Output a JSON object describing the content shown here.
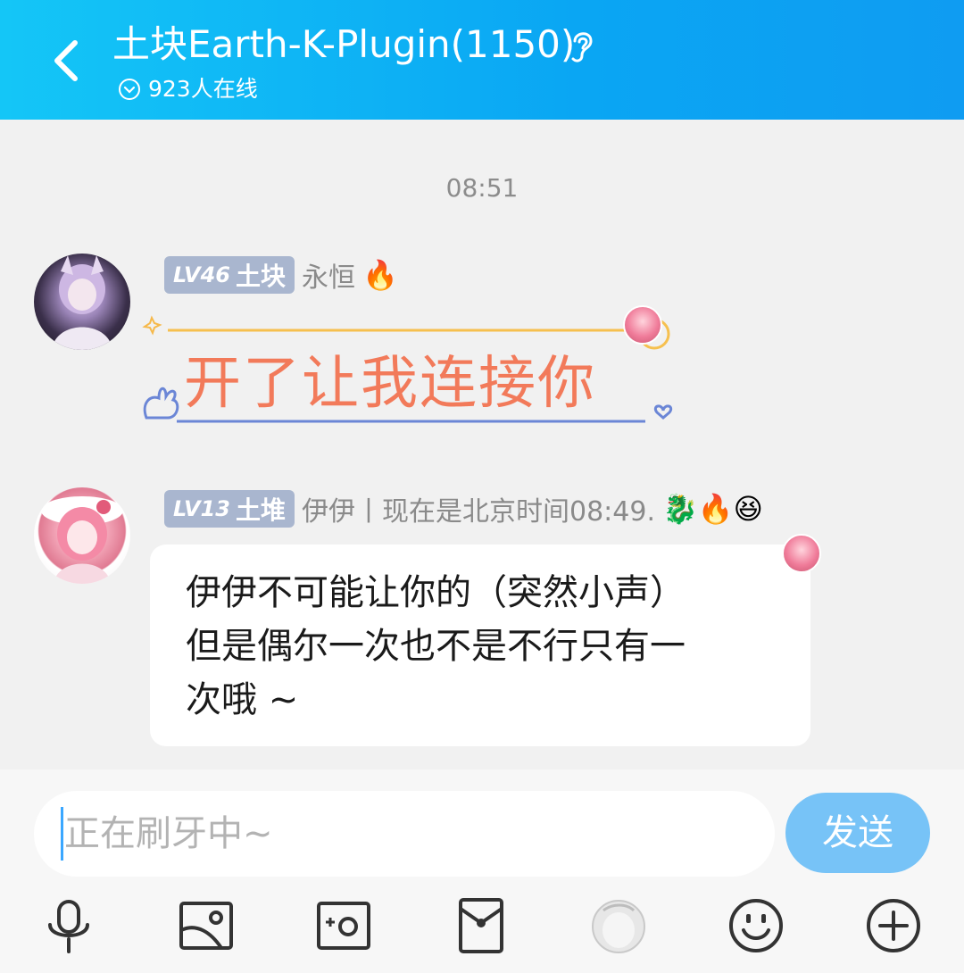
{
  "header": {
    "title": "土块Earth-K-Plugin(1150)",
    "online": "923人在线"
  },
  "chat": {
    "timestamp": "08:51",
    "messages": [
      {
        "level": "LV46",
        "title_badge": "土块",
        "sender": "永恒",
        "emojis": "🔥",
        "text": "开了让我连接你"
      },
      {
        "level": "LV13",
        "title_badge": "土堆",
        "sender": "伊伊丨现在是北京时间08:49.",
        "emojis": "🐉🔥😆",
        "lines": [
          "伊伊不可能让你的（突然小声）",
          "但是偶尔一次也不是不行只有一",
          "次哦 ~"
        ]
      }
    ]
  },
  "composer": {
    "placeholder": "正在刷牙中~",
    "send_label": "发送"
  },
  "toolbar": {
    "items": [
      "microphone-icon",
      "image-icon",
      "camera-icon",
      "red-packet-icon",
      "sticker-avatar-icon",
      "emoji-icon",
      "plus-icon"
    ]
  }
}
